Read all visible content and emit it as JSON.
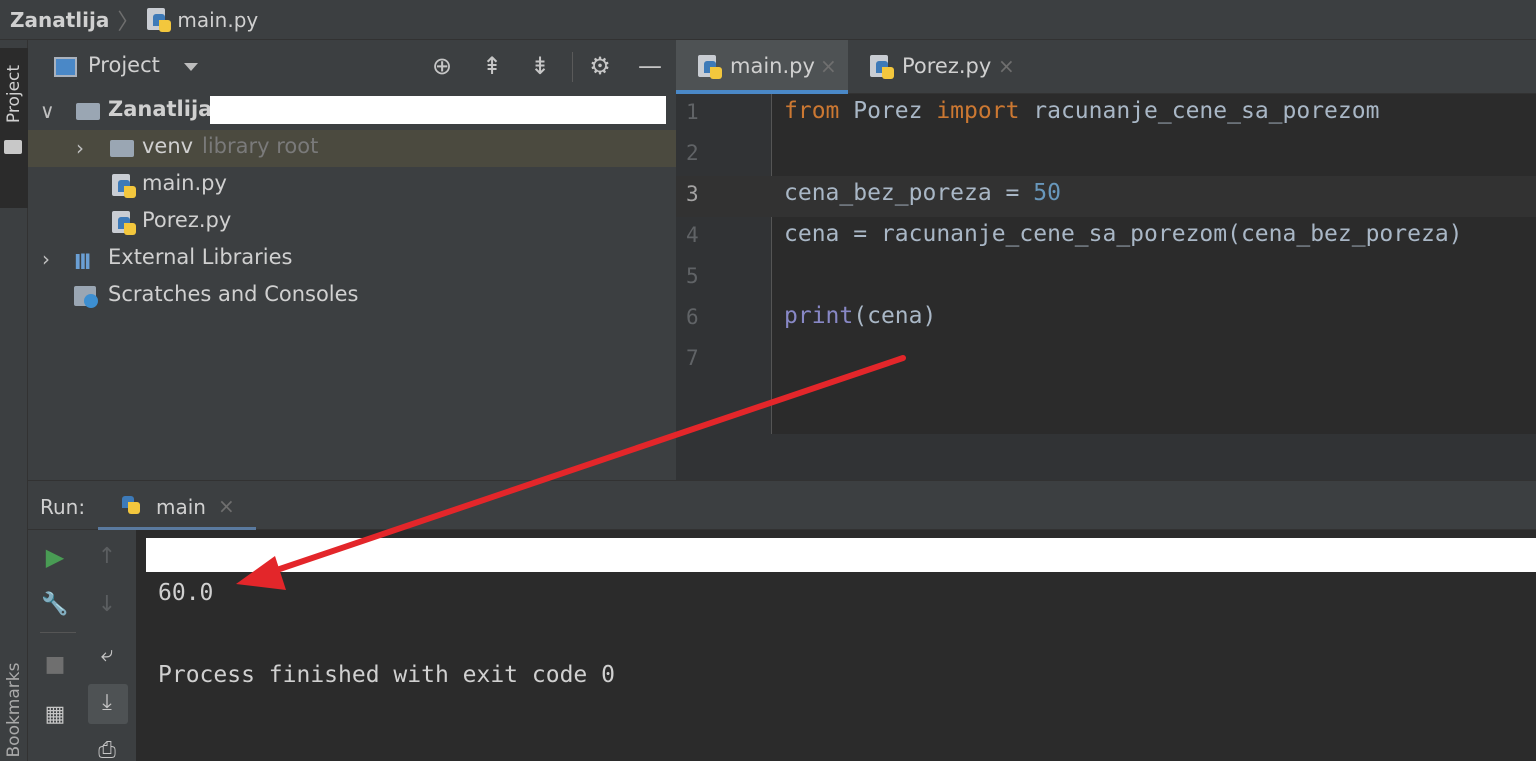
{
  "breadcrumb": {
    "project": "Zanatlija",
    "separator": "〉",
    "file": "main.py"
  },
  "left_stripe": {
    "project_label": "Project",
    "bookmarks_label": "Bookmarks"
  },
  "project_panel": {
    "title": "Project",
    "tree": [
      {
        "label": "Zanatlija",
        "hint": "",
        "type": "project-root"
      },
      {
        "label": "venv",
        "hint": "library root",
        "type": "folder"
      },
      {
        "label": "main.py",
        "hint": "",
        "type": "python-file"
      },
      {
        "label": "Porez.py",
        "hint": "",
        "type": "python-file"
      },
      {
        "label": "External Libraries",
        "hint": "",
        "type": "libraries"
      },
      {
        "label": "Scratches and Consoles",
        "hint": "",
        "type": "scratches"
      }
    ]
  },
  "editor": {
    "tabs": [
      {
        "label": "main.py",
        "close": "×",
        "active": true
      },
      {
        "label": "Porez.py",
        "close": "×",
        "active": false
      }
    ],
    "line_numbers": [
      "1",
      "2",
      "3",
      "4",
      "5",
      "6",
      "7"
    ],
    "code": {
      "line1": {
        "kw1": "from",
        "mod": " Porez ",
        "kw2": "import",
        "rest": " racunanje_cene_sa_porezom"
      },
      "line3": {
        "text": "cena_bez_poreza = ",
        "num": "50"
      },
      "line4": {
        "text": "cena = racunanje_cene_sa_porezom(cena_bez_poreza)"
      },
      "line6": {
        "fn": "print",
        "args": "(cena)"
      }
    }
  },
  "run_panel": {
    "label": "Run:",
    "tab_label": "main",
    "tab_close": "×",
    "output": [
      "60.0",
      "Process finished with exit code 0"
    ]
  },
  "colors": {
    "keyword": "#cc7832",
    "number": "#6897bb",
    "builtin": "#8888c6",
    "annotation_arrow": "#e3262a",
    "run_green": "#499c54"
  }
}
